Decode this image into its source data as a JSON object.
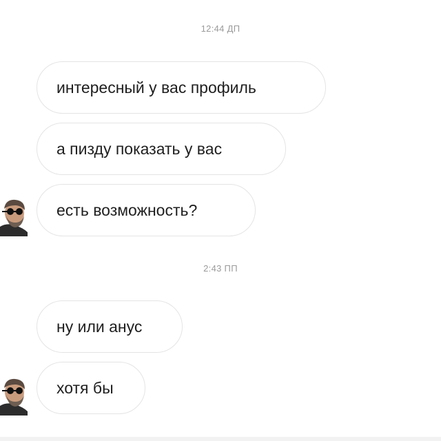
{
  "conversation": {
    "timestamps": [
      "12:44 ДП",
      "2:43 ПП"
    ],
    "messages": [
      "интересный у вас профиль",
      "а пизду показать у вас",
      "есть возможность?",
      "ну или анус",
      "хотя бы"
    ],
    "avatar_icon": "man-with-sunglasses-avatar"
  }
}
